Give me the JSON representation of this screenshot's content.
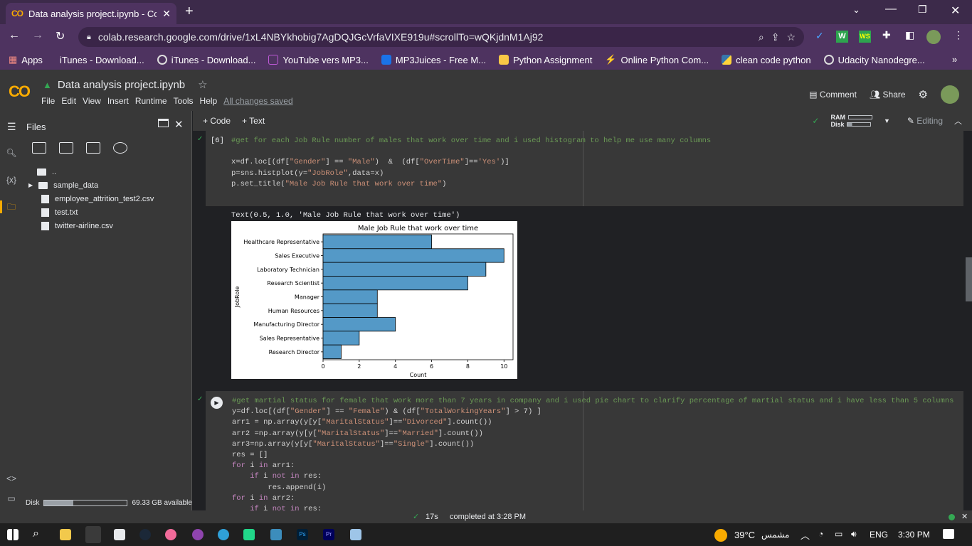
{
  "browser": {
    "tab_title": "Data analysis project.ipynb - Cola",
    "url": "colab.research.google.com/drive/1xL4NBYkhobig7AgDQJGcVrfaVIXE919u#scrollTo=wQKjdnM1Aj92",
    "bookmarks": [
      "Apps",
      "iTunes - Download...",
      "iTunes - Download...",
      "YouTube vers MP3...",
      "MP3Juices - Free M...",
      "Python Assignment",
      "Online Python Com...",
      "clean code python",
      "Udacity Nanodegre..."
    ],
    "extensions": [
      "W",
      "WS"
    ]
  },
  "colab": {
    "logo": "CO",
    "notebook_title": "Data analysis project.ipynb",
    "menu": [
      "File",
      "Edit",
      "View",
      "Insert",
      "Runtime",
      "Tools",
      "Help"
    ],
    "saved_status": "All changes saved",
    "comment_label": "Comment",
    "share_label": "Share",
    "add_code": "+ Code",
    "add_text": "+ Text",
    "ram_label": "RAM",
    "disk_label": "Disk",
    "editing_label": "Editing"
  },
  "sidebar": {
    "title": "Files",
    "items": [
      {
        "name": "..",
        "type": "parent"
      },
      {
        "name": "sample_data",
        "type": "folder"
      },
      {
        "name": "employee_attrition_test2.csv",
        "type": "file"
      },
      {
        "name": "test.txt",
        "type": "file"
      },
      {
        "name": "twitter-airline.csv",
        "type": "file"
      }
    ],
    "disk_label": "Disk",
    "disk_available": "69.33 GB available",
    "disk_used_fraction": 0.35
  },
  "cells": {
    "cell1": {
      "exec_count": "[6]",
      "comment": "#get for each Job Rule number of males that work over time and i used histogram to help me use many columns",
      "output_text": "Text(0.5, 1.0, 'Male Job Rule that work over time')"
    },
    "cell2": {
      "comment": "#get martial status for female that work more than 7 years in company and i used pie chart to clarify percentage of martial status and i have less than 5 columns"
    }
  },
  "chart_data": {
    "type": "bar",
    "orientation": "horizontal",
    "title": "Male Job Rule that work over time",
    "xlabel": "Count",
    "ylabel": "JobRole",
    "categories": [
      "Healthcare Representative",
      "Sales Executive",
      "Laboratory Technician",
      "Research Scientist",
      "Manager",
      "Human Resources",
      "Manufacturing Director",
      "Sales Representative",
      "Research Director"
    ],
    "values": [
      6,
      10,
      9,
      8,
      3,
      3,
      4,
      2,
      1
    ],
    "xlim": [
      0,
      10.5
    ],
    "xticks": [
      0,
      2,
      4,
      6,
      8,
      10
    ],
    "bar_color": "#5499c7",
    "grid": false
  },
  "status": {
    "duration": "17s",
    "message": "completed at 3:28 PM"
  },
  "taskbar": {
    "weather": "39°C",
    "weather_text": "مشمس",
    "lang": "ENG",
    "time": "3:30 PM"
  }
}
